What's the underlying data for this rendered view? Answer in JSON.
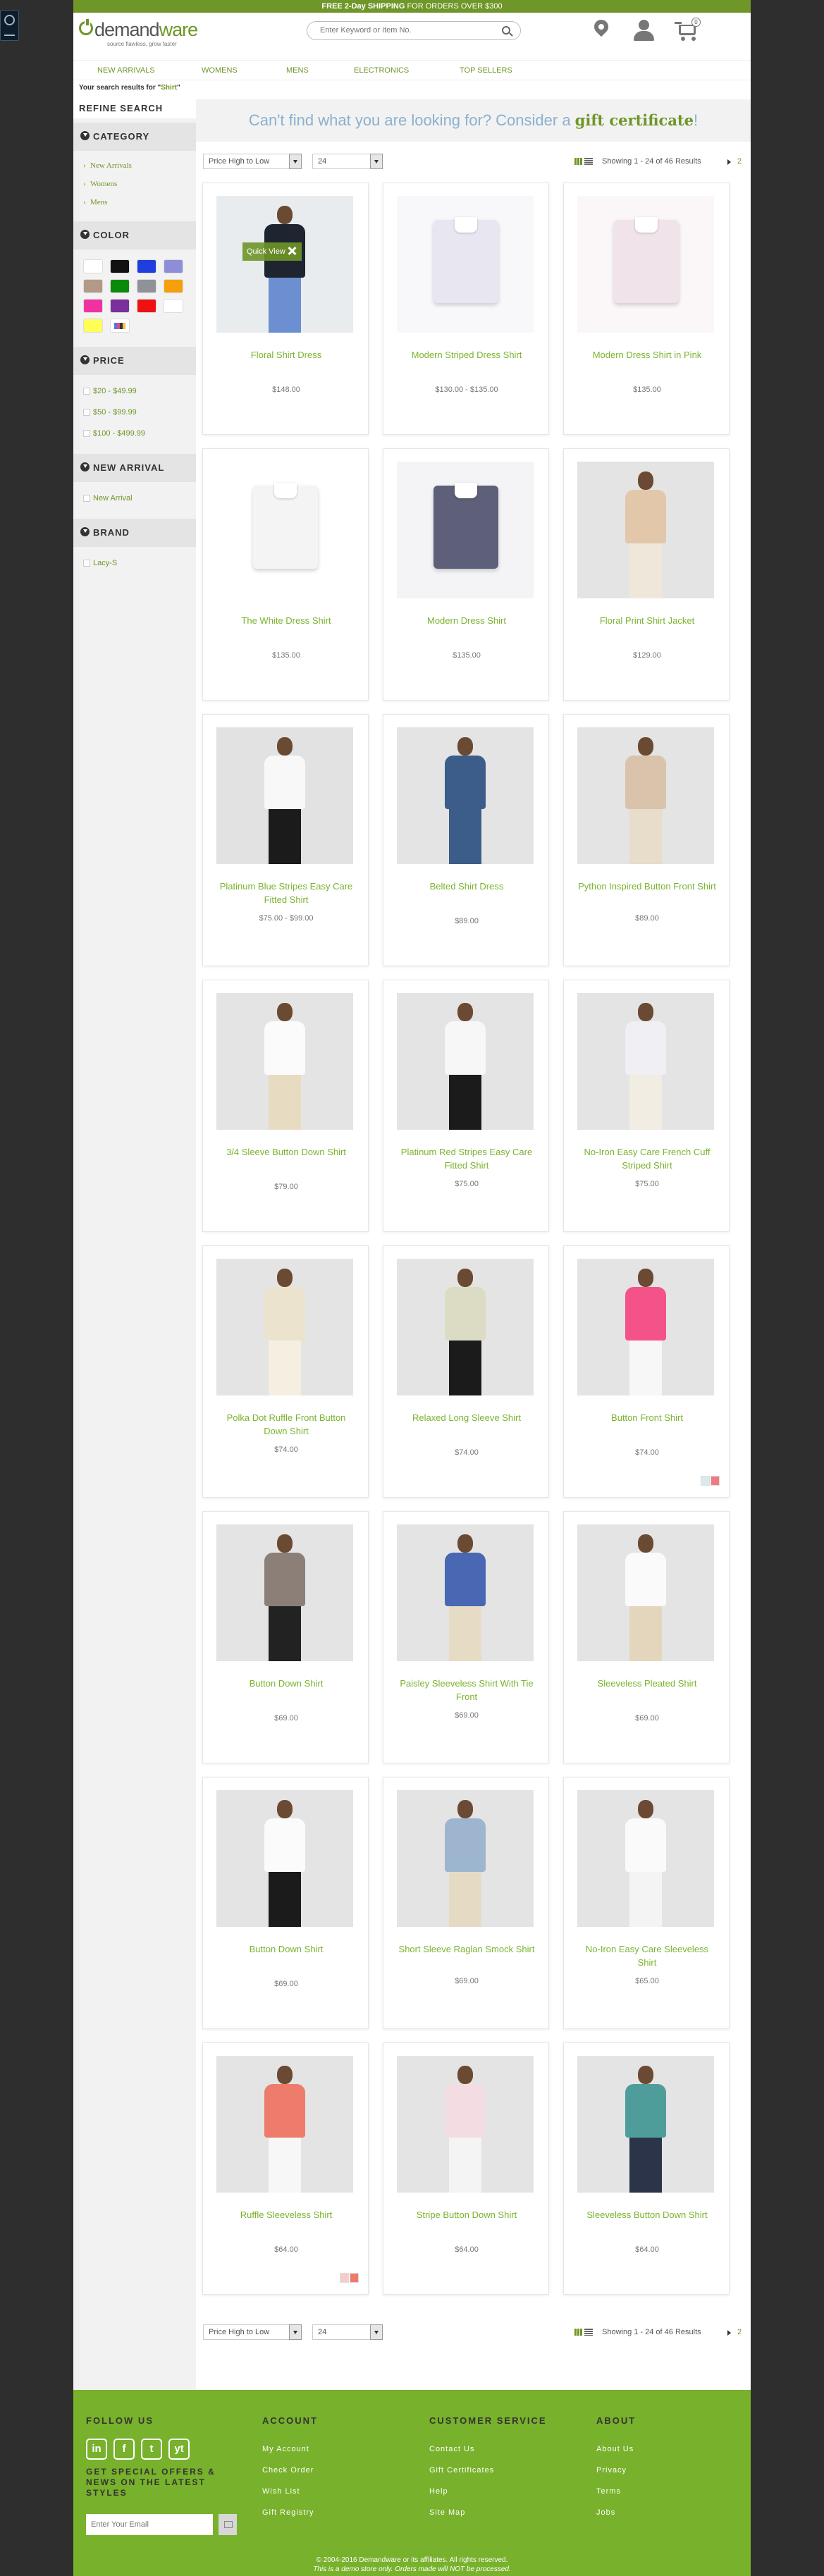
{
  "promo": {
    "bold": "FREE 2-Day SHIPPING",
    "rest": " FOR ORDERS OVER $300"
  },
  "brand": {
    "name_a": "demand",
    "name_b": "ware",
    "tagline": "source flawless, grow faster"
  },
  "search": {
    "placeholder": "Enter Keyword or Item No."
  },
  "cart": {
    "count": "0"
  },
  "nav": [
    "NEW ARRIVALS",
    "WOMENS",
    "MENS",
    "ELECTRONICS",
    "TOP SELLERS"
  ],
  "results": {
    "prefix": "Your search results for \"",
    "query": "Shirt",
    "suffix": "\""
  },
  "sidebar": {
    "refine": "REFINE SEARCH",
    "category_title": "CATEGORY",
    "categories": [
      "New Arrivals",
      "Womens",
      "Mens"
    ],
    "color_title": "COLOR",
    "colors": [
      "#ffffff",
      "#111111",
      "#1f3ee0",
      "#8e8ed8",
      "#b29a86",
      "#0a8a0a",
      "#8f9398",
      "#f59f0a",
      "#f032a0",
      "#7a2f9a",
      "#ee1111",
      "#ffffff",
      "#ffff55",
      "miscellaneous"
    ],
    "price_title": "PRICE",
    "prices": [
      "$20 - $49.99",
      "$50 - $99.99",
      "$100 - $499.99"
    ],
    "newarrival_title": "NEW ARRIVAL",
    "newarrival": [
      "New Arrival"
    ],
    "brand_title": "BRAND",
    "brands": [
      "Lacy-S"
    ]
  },
  "banner": {
    "text": "Can't find what you are looking for? Consider a ",
    "link": "gift certificate",
    "end": "!"
  },
  "toolbar": {
    "sort": "Price High to Low",
    "page_size": "24",
    "count": "Showing 1 - 24 of 46 Results",
    "next_page": "2"
  },
  "quickview": {
    "label": "Quick View"
  },
  "products": [
    {
      "name": "Floral Shirt Dress",
      "price": "$148.00",
      "image": "woman-floral-dress"
    },
    {
      "name": "Modern Striped Dress Shirt",
      "price": "$130.00 - $135.00",
      "image": "folded-striped-shirt"
    },
    {
      "name": "Modern Dress Shirt in Pink",
      "price": "$135.00",
      "image": "folded-pink-shirt"
    },
    {
      "name": "The White Dress Shirt",
      "price": "$135.00",
      "image": "folded-white-shirt"
    },
    {
      "name": "Modern Dress Shirt",
      "price": "$135.00",
      "image": "folded-blue-shirt"
    },
    {
      "name": "Floral Print Shirt Jacket",
      "price": "$129.00",
      "image": "woman-print-jacket"
    },
    {
      "name": "Platinum Blue Stripes Easy Care Fitted Shirt",
      "price": "$75.00 - $99.00",
      "image": "woman-white-shirt"
    },
    {
      "name": "Belted Shirt Dress",
      "price": "$89.00",
      "image": "woman-denim-dress"
    },
    {
      "name": "Python Inspired Button Front Shirt",
      "price": "$89.00",
      "image": "woman-beige-shirt"
    },
    {
      "name": "3/4 Sleeve Button Down Shirt",
      "price": "$79.00",
      "image": "woman-white-blouse"
    },
    {
      "name": "Platinum Red Stripes Easy Care Fitted Shirt",
      "price": "$75.00",
      "image": "woman-white-fitted"
    },
    {
      "name": "No-Iron Easy Care French Cuff Striped Shirt",
      "price": "$75.00",
      "image": "woman-striped-shirt"
    },
    {
      "name": "Polka Dot Ruffle Front Button Down Shirt",
      "price": "$74.00",
      "image": "woman-ruffle-blouse"
    },
    {
      "name": "Relaxed Long Sleeve Shirt",
      "price": "$74.00",
      "image": "woman-print-shirt"
    },
    {
      "name": "Button Front Shirt",
      "price": "$74.00",
      "image": "woman-pink-shirt"
    },
    {
      "name": "Button Down Shirt",
      "price": "$69.00",
      "image": "woman-grey-shirt"
    },
    {
      "name": "Paisley Sleeveless Shirt With Tie Front",
      "price": "$69.00",
      "image": "woman-blue-sleeveless"
    },
    {
      "name": "Sleeveless Pleated Shirt",
      "price": "$69.00",
      "image": "woman-white-sleeveless"
    },
    {
      "name": "Button Down Shirt",
      "price": "$69.00",
      "image": "woman-white-tunic"
    },
    {
      "name": "Short Sleeve Raglan Smock Shirt",
      "price": "$69.00",
      "image": "woman-blue-smock"
    },
    {
      "name": "No-Iron Easy Care Sleeveless Shirt",
      "price": "$65.00",
      "image": "woman-white-noiron"
    },
    {
      "name": "Ruffle Sleeveless Shirt",
      "price": "$64.00",
      "image": "woman-coral-ruffle"
    },
    {
      "name": "Stripe Button Down Shirt",
      "price": "$64.00",
      "image": "woman-pink-stripe"
    },
    {
      "name": "Sleeveless Button Down Shirt",
      "price": "$64.00",
      "image": "woman-plaid-shirt"
    }
  ],
  "footer": {
    "follow": "FOLLOW US",
    "social": [
      "in",
      "f",
      "t",
      "yt"
    ],
    "offers": "GET SPECIAL OFFERS & NEWS ON THE LATEST STYLES",
    "email_placeholder": "Enter Your Email",
    "account_title": "ACCOUNT",
    "account": [
      "My Account",
      "Check Order",
      "Wish List",
      "Gift Registry"
    ],
    "service_title": "CUSTOMER SERVICE",
    "service": [
      "Contact Us",
      "Gift Certificates",
      "Help",
      "Site Map"
    ],
    "about_title": "ABOUT",
    "about": [
      "About Us",
      "Privacy",
      "Terms",
      "Jobs"
    ],
    "copyright": "© 2004-2016 Demandware or its affiliates. All rights reserved.",
    "disclaimer": "This is a demo store only. Orders made will NOT be processed."
  }
}
